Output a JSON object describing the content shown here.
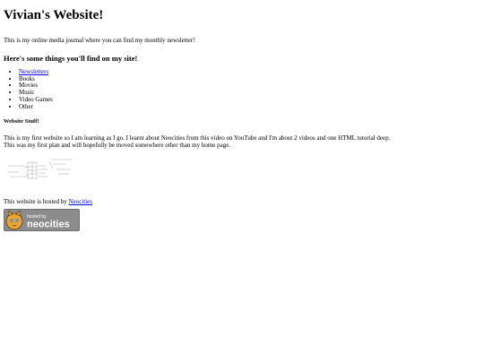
{
  "site": {
    "title": "Vivian's Website!",
    "intro": "This is my online media journal where you can find my monthly newsletter!"
  },
  "things": {
    "heading": "Here's some things you'll find on my site!",
    "items": [
      {
        "label": "Newsletters",
        "link": true
      },
      {
        "label": "Books"
      },
      {
        "label": "Movies"
      },
      {
        "label": "Music"
      },
      {
        "label": "Video Games"
      },
      {
        "label": "Other"
      }
    ]
  },
  "website_stuff": {
    "heading": "Website Stuff!",
    "line1": "This is my first website so I am learning as I go. I learnt about Neocities from this video on YouTube and I'm about 2 videos and one HTML tutorial deep.",
    "line2": "This was my first plan and will hopefully be moved somewhere other than my home page."
  },
  "hosting": {
    "prefix": "This website is hosted by ",
    "link_text": "Neocities",
    "badge_top": "hosted by",
    "badge_main": "neocities",
    "badge_bg": "#8c8c8c",
    "badge_icon_color": "#e8a53a"
  }
}
